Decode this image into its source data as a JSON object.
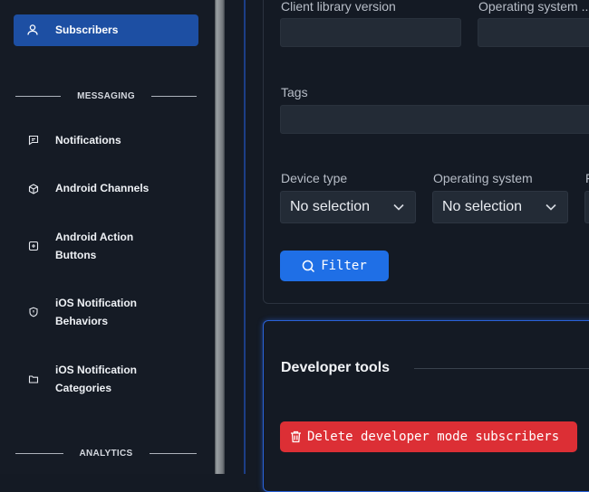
{
  "sidebar": {
    "active_item": {
      "label": "Subscribers",
      "icon": "user-icon"
    },
    "sections": [
      {
        "label": "MESSAGING"
      },
      {
        "label": "ANALYTICS"
      }
    ],
    "items": [
      {
        "label": "Notifications",
        "icon": "message-icon"
      },
      {
        "label": "Android Channels",
        "icon": "cube-icon"
      },
      {
        "label": "Android Action Buttons",
        "icon": "plus-square-icon"
      },
      {
        "label": "iOS Notification Behaviors",
        "icon": "shield-icon"
      },
      {
        "label": "iOS Notification Categories",
        "icon": "folder-icon"
      }
    ]
  },
  "filters": {
    "client_library_version": {
      "label": "Client library version",
      "value": ""
    },
    "operating_system_version": {
      "label": "Operating system ...",
      "value": ""
    },
    "tags": {
      "label": "Tags",
      "value": ""
    },
    "device_type": {
      "label": "Device type",
      "value": "No selection"
    },
    "operating_system": {
      "label": "Operating system",
      "value": "No selection"
    },
    "third_label_partial": "F",
    "filter_button": "Filter"
  },
  "developer_tools": {
    "title": "Developer tools",
    "delete_button": "Delete developer mode subscribers"
  },
  "colors": {
    "accent": "#1f6fe6",
    "active_nav": "#1d4fa3",
    "danger": "#dc2f35"
  }
}
